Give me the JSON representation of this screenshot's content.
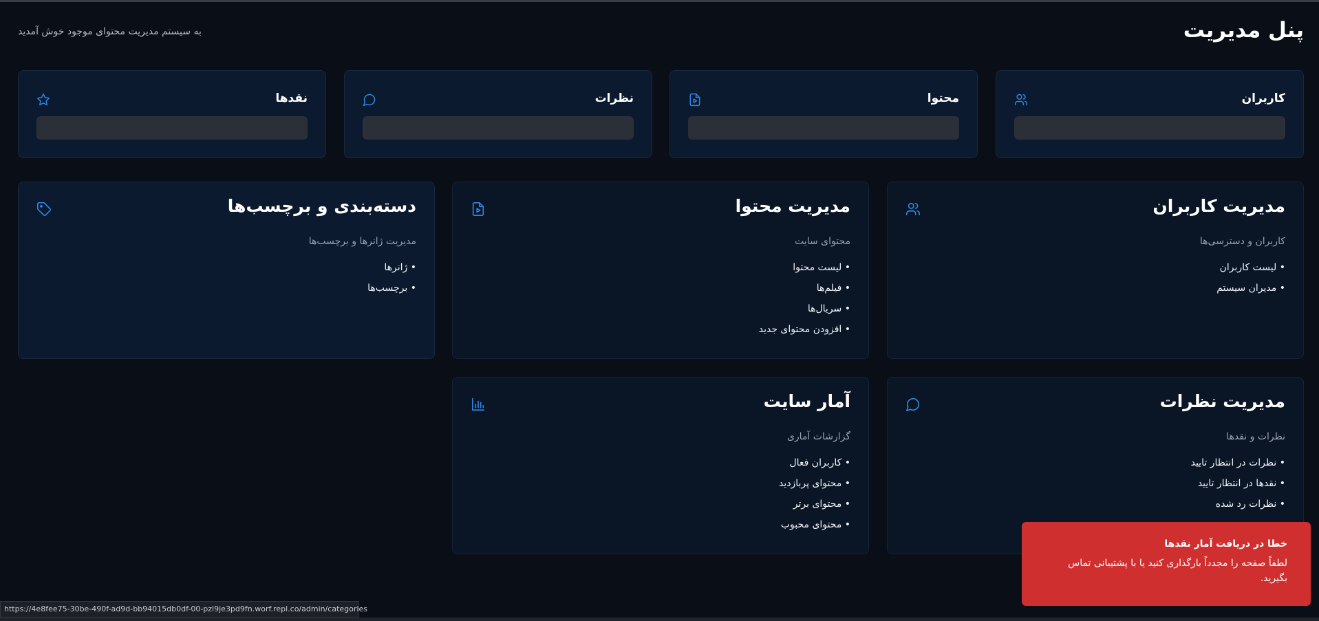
{
  "header": {
    "title": "پنل مدیریت",
    "welcome": "به سیستم مدیریت محتوای موجود خوش آمدید"
  },
  "stats": [
    {
      "title": "کاربران",
      "icon": "users-icon"
    },
    {
      "title": "محتوا",
      "icon": "file-play-icon"
    },
    {
      "title": "نظرات",
      "icon": "message-circle-icon"
    },
    {
      "title": "نقدها",
      "icon": "star-icon"
    }
  ],
  "sections": {
    "users": {
      "title": "مدیریت کاربران",
      "subtitle": "کاربران و دسترسی‌ها",
      "icon": "users-icon",
      "items": [
        "• لیست کاربران",
        "• مدیران سیستم"
      ]
    },
    "content": {
      "title": "مدیریت محتوا",
      "subtitle": "محتوای سایت",
      "icon": "file-play-icon",
      "items": [
        "• لیست محتوا",
        "• فیلم‌ها",
        "• سریال‌ها",
        "• افزودن محتوای جدید"
      ]
    },
    "categories": {
      "title": "دسته‌بندی و برچسب‌ها",
      "subtitle": "مدیریت ژانرها و برچسب‌ها",
      "icon": "tag-icon",
      "items": [
        "• ژانرها",
        "• برچسب‌ها"
      ]
    },
    "comments": {
      "title": "مدیریت نظرات",
      "subtitle": "نظرات و نقدها",
      "icon": "message-circle-icon",
      "items": [
        "• نظرات در انتظار تایید",
        "• نقدها در انتظار تایید",
        "• نظرات رد شده"
      ]
    },
    "stats": {
      "title": "آمار سایت",
      "subtitle": "گزارشات آماری",
      "icon": "bar-chart-icon",
      "items": [
        "• کاربران فعال",
        "• محتوای پربازدید",
        "• محتوای برتر",
        "• محتوای محبوب"
      ]
    }
  },
  "toast": {
    "title": "خطا در دریافت آمار نقدها",
    "message": "لطفاً صفحه را مجدداً بارگذاری کنید یا با پشتیبانی تماس بگیرید."
  },
  "status_url": "https://4e8fee75-30be-490f-ad9d-bb94015db0df-00-pzl9je3pd9fn.worf.repl.co/admin/categories",
  "colors": {
    "background": "#0a0e17",
    "card": "#0b1a2e",
    "accent": "#2f86e6",
    "toast": "#d02f2f"
  }
}
